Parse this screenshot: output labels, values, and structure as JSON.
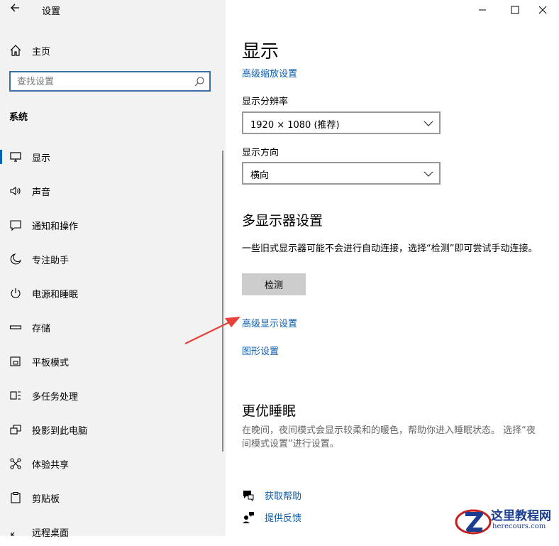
{
  "window": {
    "title": "设置",
    "back_icon": "back-arrow-icon",
    "controls": [
      "minimize",
      "maximize",
      "close"
    ]
  },
  "sidebar": {
    "home_label": "主页",
    "search_placeholder": "查找设置",
    "section": "系统",
    "items": [
      {
        "label": "显示",
        "icon": "monitor-icon",
        "active": true
      },
      {
        "label": "声音",
        "icon": "speaker-icon"
      },
      {
        "label": "通知和操作",
        "icon": "notification-icon"
      },
      {
        "label": "专注助手",
        "icon": "moon-icon"
      },
      {
        "label": "电源和睡眠",
        "icon": "power-icon"
      },
      {
        "label": "存储",
        "icon": "storage-icon"
      },
      {
        "label": "平板模式",
        "icon": "tablet-icon"
      },
      {
        "label": "多任务处理",
        "icon": "multitask-icon"
      },
      {
        "label": "投影到此电脑",
        "icon": "project-icon"
      },
      {
        "label": "体验共享",
        "icon": "share-icon"
      },
      {
        "label": "剪贴板",
        "icon": "clipboard-icon"
      },
      {
        "label": "远程桌面",
        "icon": "remote-icon"
      }
    ]
  },
  "main": {
    "title": "显示",
    "advanced_scaling_link": "高级缩放设置",
    "resolution_label": "显示分辨率",
    "resolution_value": "1920 × 1080 (推荐)",
    "orientation_label": "显示方向",
    "orientation_value": "横向",
    "multi_display_heading": "多显示器设置",
    "multi_display_text": "一些旧式显示器可能不会进行自动连接，选择“检测”即可尝试手动连接。",
    "detect_button": "检测",
    "advanced_display_link": "高级显示设置",
    "graphics_link": "图形设置",
    "sleep_heading": "更优睡眠",
    "sleep_text": "在晚间，夜间模式会显示较柔和的暖色，帮助你进入睡眠状态。 选择“夜间模式设置”进行设置。",
    "get_help": "获取帮助",
    "feedback": "提供反馈"
  },
  "watermark": {
    "name": "这里教程网",
    "url": "herecours.com"
  },
  "colors": {
    "accent": "#0063b1",
    "link": "#0b5cad",
    "arrow": "#e8403a"
  }
}
